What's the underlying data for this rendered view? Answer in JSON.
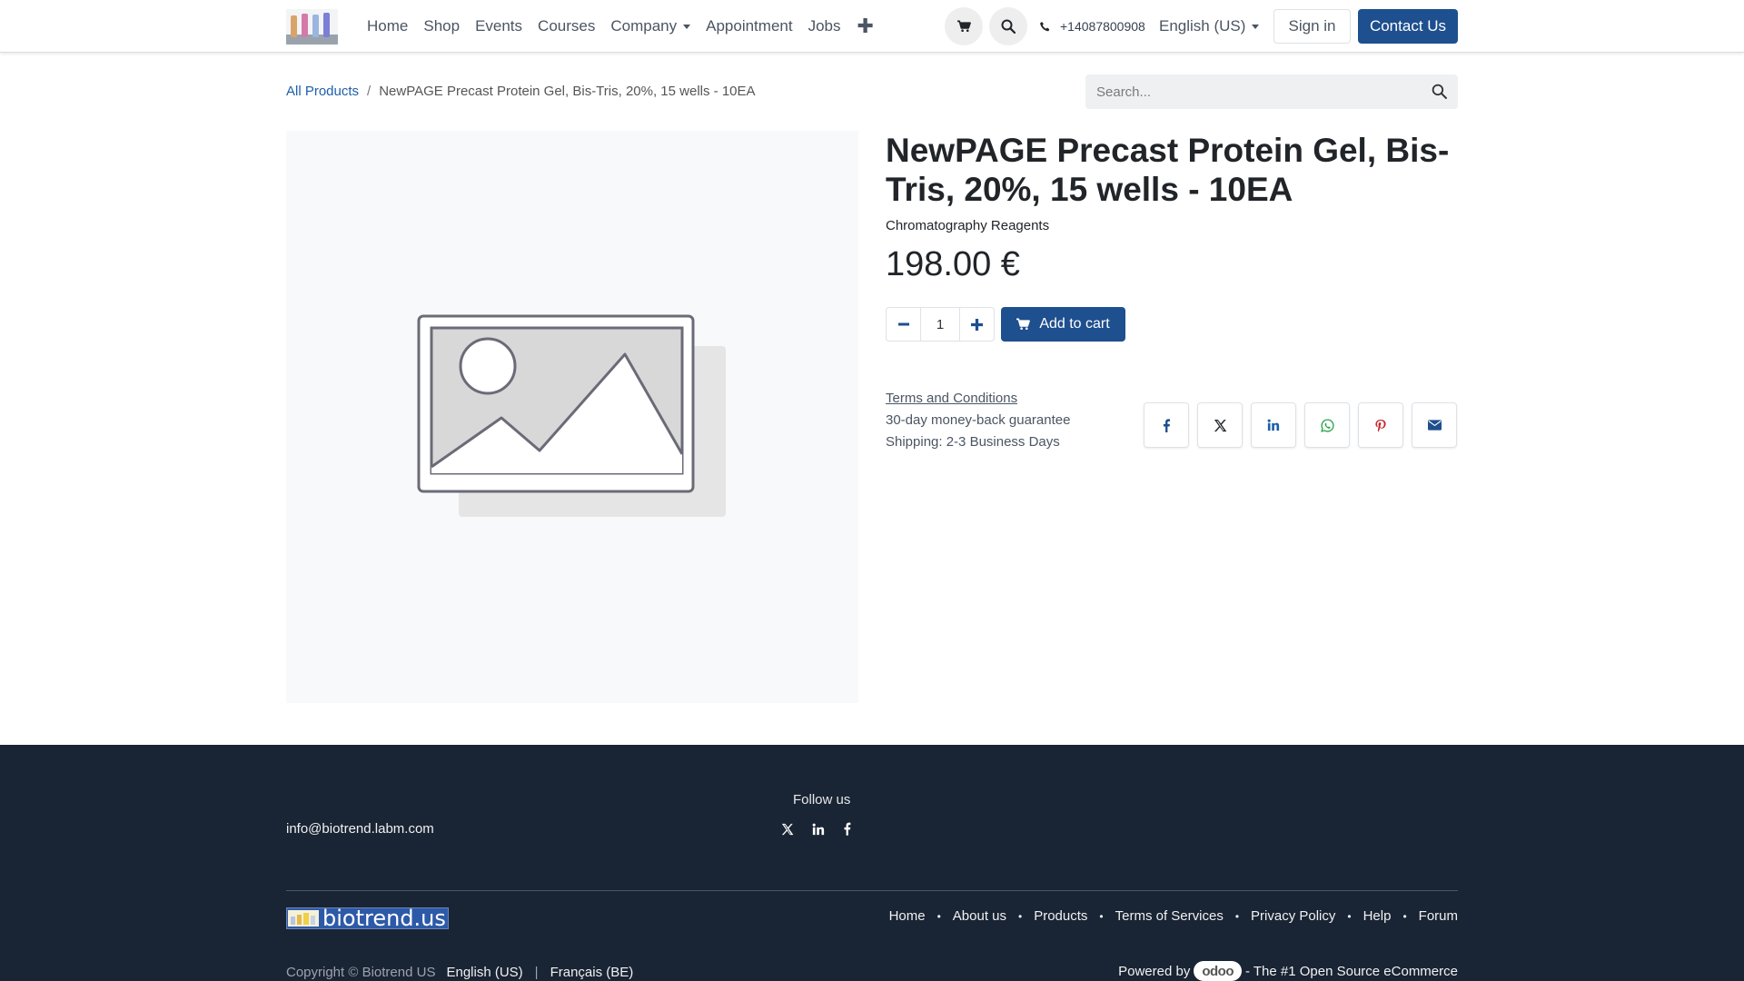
{
  "header": {
    "nav": [
      "Home",
      "Shop",
      "Events",
      "Courses",
      "Company",
      "Appointment",
      "Jobs"
    ],
    "phone": "+14087800908",
    "language": "English (US)",
    "signin_label": "Sign in",
    "contact_label": "Contact Us",
    "icons": [
      "cart-icon",
      "search-icon",
      "phone-icon",
      "plus-icon"
    ]
  },
  "breadcrumb": {
    "root": "All Products",
    "current": "NewPAGE Precast Protein Gel, Bis-Tris, 20%, 15 wells - 10EA"
  },
  "search": {
    "placeholder": "Search..."
  },
  "product": {
    "title": "NewPAGE Precast Protein Gel, Bis-Tris, 20%, 15 wells - 10EA",
    "category": "Chromatography Reagents",
    "price": "198.00 €",
    "quantity": "1",
    "add_to_cart_label": "Add to cart",
    "terms_link": "Terms and Conditions",
    "guarantee": "30-day money-back guarantee",
    "shipping": "Shipping: 2-3 Business Days",
    "share_icons": [
      "facebook-icon",
      "x-icon",
      "linkedin-icon",
      "whatsapp-icon",
      "pinterest-icon",
      "email-icon"
    ]
  },
  "colors": {
    "primary": "#1e4f8e",
    "footer_bg": "#192434",
    "link": "#1e5fa8"
  },
  "footer": {
    "follow_us": "Follow us",
    "email": "info@biotrend.labm.com",
    "brand": "biotrend.us",
    "links": [
      "Home",
      "About us",
      "Products",
      "Terms of Services",
      "Privacy Policy",
      "Help",
      "Forum"
    ],
    "copyright": "Copyright © Biotrend US",
    "languages": [
      "English (US)",
      "Français (BE)"
    ],
    "powered_by": "Powered by",
    "odoo": "odoo",
    "tagline": "- The #1 Open Source eCommerce"
  }
}
